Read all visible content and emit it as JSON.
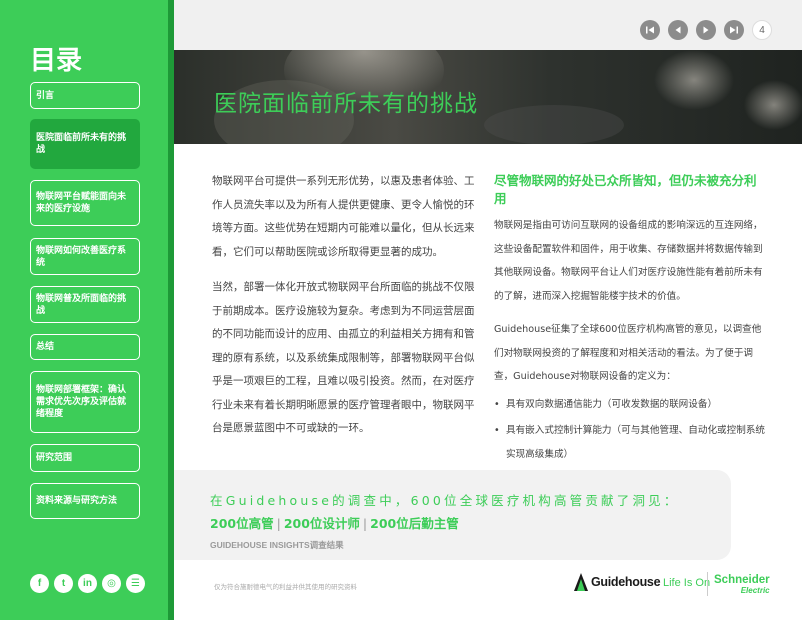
{
  "sidebar": {
    "title": "目录",
    "items": [
      {
        "label": "引言"
      },
      {
        "label": "医院面临前所未有的挑战"
      },
      {
        "label": "物联网平台赋能面向未来的医疗设施"
      },
      {
        "label": "物联网如何改善医疗系统"
      },
      {
        "label": "物联网普及所面临的挑战"
      },
      {
        "label": "总结"
      },
      {
        "label": "物联网部署框架：确认需求优先次序及评估就绪程度"
      },
      {
        "label": "研究范围"
      },
      {
        "label": "资料来源与研究方法"
      }
    ],
    "active_index": 1,
    "social": [
      {
        "icon": "facebook-icon",
        "glyph": "f"
      },
      {
        "icon": "twitter-icon",
        "glyph": "t"
      },
      {
        "icon": "linkedin-icon",
        "glyph": "in"
      },
      {
        "icon": "instagram-icon",
        "glyph": "◎"
      },
      {
        "icon": "rss-icon",
        "glyph": "☰"
      }
    ]
  },
  "nav": {
    "page_number": "4"
  },
  "hero": {
    "title": "医院面临前所未有的挑战"
  },
  "left_column": {
    "para1": "物联网平台可提供一系列无形优势，以惠及患者体验、工作人员流失率以及为所有人提供更健康、更令人愉悦的环境等方面。这些优势在短期内可能难以量化，但从长远来看，它们可以帮助医院或诊所取得更显著的成功。",
    "para2": "当然，部署一体化开放式物联网平台所面临的挑战不仅限于前期成本。医疗设施较为复杂。考虑到为不同运营层面的不同功能而设计的应用、由孤立的利益相关方拥有和管理的原有系统，以及系统集成限制等，部署物联网平台似乎是一项艰巨的工程，且难以吸引投资。然而，在对医疗行业未来有着长期明晰愿景的医疗管理者眼中，物联网平台是愿景蓝图中不可或缺的一环。"
  },
  "right_column": {
    "heading": "尽管物联网的好处已众所皆知，但仍未被充分利用",
    "para1": "物联网是指由可访问互联网的设备组成的影响深远的互连网络，这些设备配置软件和固件，用于收集、存储数据并将数据传输到其他联网设备。物联网平台让人们对医疗设施性能有着前所未有的了解，进而深入挖掘智能楼宇技术的价值。",
    "para2": "Guidehouse征集了全球600位医疗机构高管的意见，以调查他们对物联网投资的了解程度和对相关活动的看法。为了便于调查，Guidehouse对物联网设备的定义为：",
    "bullets": [
      "具有双向数据通信能力（可收发数据的联网设备）",
      "具有嵌入式控制计算能力（可与其他管理、自动化或控制系统实现高级集成）"
    ]
  },
  "callout": {
    "line1": "在Guidehouse的调查中，600位全球医疗机构高管贡献了洞见：",
    "stats": [
      "200位高管",
      "200位设计师",
      "200位后勤主管"
    ],
    "separator": "|",
    "source": "GUIDEHOUSE INSIGHTS调查结果"
  },
  "footer": {
    "disclaimer": "仅为符合施耐德电气的利益并供其使用的研究资料",
    "logo_guidehouse": "Guidehouse",
    "logo_lifeison": "Life Is On",
    "logo_schneider": "Schneider",
    "logo_electric": "Electric"
  },
  "colors": {
    "brand_green": "#3dcd58",
    "sidebar_dark": "#1e9a37",
    "nav_grey": "#8c8c8c"
  }
}
